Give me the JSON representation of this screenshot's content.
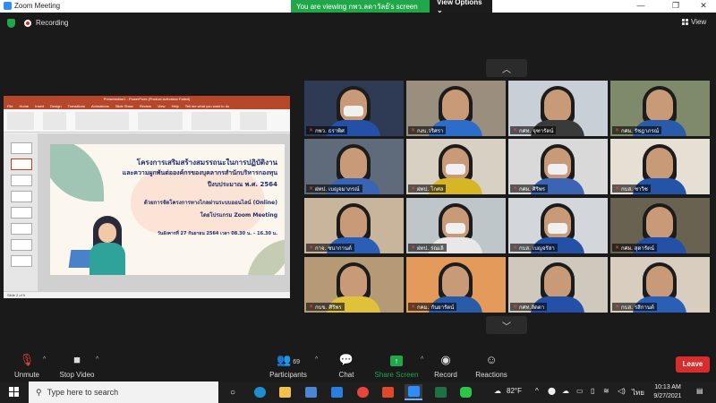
{
  "window": {
    "title": "Zoom Meeting",
    "minimize": "—",
    "maximize": "❐",
    "close": "✕"
  },
  "banner": {
    "viewing_text": "You are viewing กพว.ลดาวัลย์'s screen",
    "options_label": "View Options ⌄"
  },
  "recording": {
    "label": "Recording"
  },
  "view_button": {
    "label": "View"
  },
  "shared_screen": {
    "app_title": "Presentation1 - PowerPoint (Product Activation Failed)",
    "tabs": [
      "File",
      "Home",
      "Insert",
      "Design",
      "Transitions",
      "Animations",
      "Slide Show",
      "Review",
      "View",
      "Help",
      "Tell me what you want to do"
    ],
    "slide_lines": [
      "โครงการเสริมสร้างสมรรถนะในการปฏิบัติงาน",
      "และความผูกพันต่อองค์กรของบุคลากรสำนักบริหารกองทุน",
      "ปีงบประมาณ พ.ศ. 2564",
      "ด้วยการจัดโครงการทางไกลผ่านระบบออนไลน์ (Online)",
      "โดยโปรแกรม Zoom Meeting",
      "วันอังคารที่ 27 กันยายน 2564  เวลา 08.30 น. – 16.30 น."
    ],
    "status_text": "Slide 2 of 9"
  },
  "participants_grid": [
    {
      "name": "กพว. ธราพิศ",
      "bg": "#2f3b55",
      "torso": "#2550a8",
      "mask": true
    },
    {
      "name": "กงบ.วริศรา",
      "bg": "#9a8f7e",
      "torso": "#2b6dc9",
      "mask": false
    },
    {
      "name": "กศท. จุฑารัตน์",
      "bg": "#c9cfd6",
      "torso": "#3a3a3a",
      "mask": false
    },
    {
      "name": "กศผ. รัชฎาภรณ์",
      "bg": "#7f8a6a",
      "torso": "#2a5ba8",
      "mask": false
    },
    {
      "name": "ฝทป. เบญจมาภรณ์",
      "bg": "#5f6b7a",
      "torso": "#3c64b4",
      "mask": false
    },
    {
      "name": "ฝทป. โกศล",
      "bg": "#d8d0c2",
      "torso": "#d7b626",
      "mask": true
    },
    {
      "name": "กศผ. ศิริพร",
      "bg": "#d9d9d9",
      "torso": "#3c64b4",
      "mask": true
    },
    {
      "name": "กบส. ชาวิช",
      "bg": "#e6dfd3",
      "torso": "#2454a6",
      "mask": false
    },
    {
      "name": "กาจ. ชนากานต์",
      "bg": "#c9b59c",
      "torso": "#2b5fb6",
      "mask": false
    },
    {
      "name": "ฝทป. รณเลิ",
      "bg": "#bfc6c9",
      "torso": "#e8e8e8",
      "mask": true
    },
    {
      "name": "กบส. เบญจรัสา",
      "bg": "#d3d6da",
      "torso": "#2550a8",
      "mask": true
    },
    {
      "name": "กศผ. สุดารัตน์",
      "bg": "#6a6250",
      "torso": "#2550a8",
      "mask": false
    },
    {
      "name": "กบข. ศิริพร",
      "bg": "#b59a75",
      "torso": "#e0c23a",
      "mask": false
    },
    {
      "name": "กคม. กันยารัตน์",
      "bg": "#e39a5a",
      "torso": "#2a5ba8",
      "mask": false
    },
    {
      "name": "กศท.ลัดดา",
      "bg": "#cfc8bd",
      "torso": "#2550a8",
      "mask": false
    },
    {
      "name": "กบส. รสิกานต์",
      "bg": "#d8cdbf",
      "torso": "#2b5fb6",
      "mask": false
    }
  ],
  "pager": {
    "up": "︿",
    "down": "﹀"
  },
  "toolbar": {
    "unmute": "Unmute",
    "stop_video": "Stop Video",
    "participants": "Participants",
    "participants_count": "69",
    "chat": "Chat",
    "share_screen": "Share Screen",
    "record": "Record",
    "reactions": "Reactions",
    "leave": "Leave"
  },
  "taskbar": {
    "search_placeholder": "Type here to search",
    "weather": "82°F",
    "language": "ไทย",
    "time": "10:13 AM",
    "date": "9/27/2021"
  },
  "colors": {
    "zoom_blue": "#2d8cff",
    "green_banner": "#1fa74a",
    "leave_red": "#d92c2c",
    "ppt_orange": "#b7472a"
  }
}
